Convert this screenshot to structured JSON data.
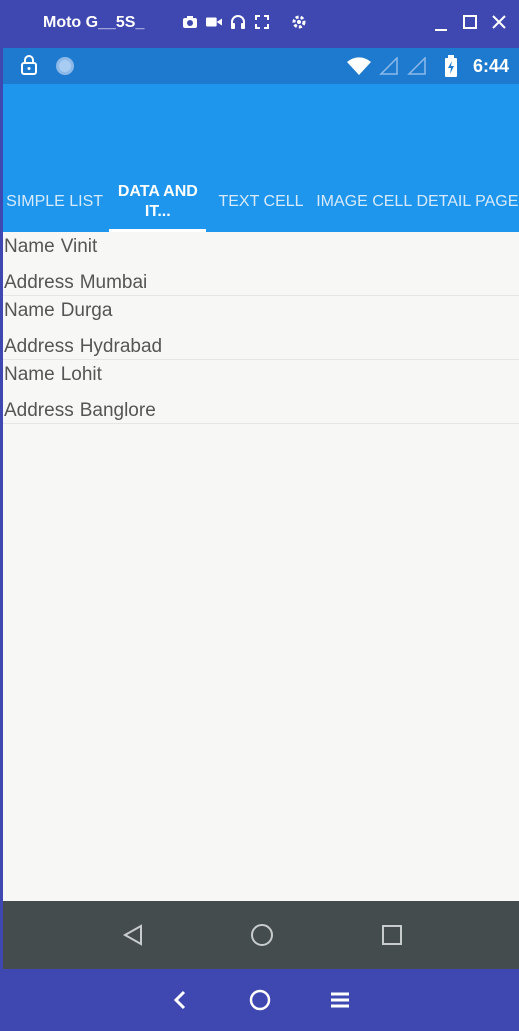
{
  "window": {
    "title": "Moto G__5S_"
  },
  "status": {
    "time": "6:44"
  },
  "tabs": [
    {
      "label": "SIMPLE LIST"
    },
    {
      "label": "DATA AND IT..."
    },
    {
      "label": "TEXT CELL"
    },
    {
      "label": "IMAGE CELL"
    },
    {
      "label": "DETAIL PAGE"
    }
  ],
  "items": [
    {
      "name_label": "Name",
      "name": "Vinit",
      "address_label": "Address",
      "address": "Mumbai"
    },
    {
      "name_label": "Name",
      "name": "Durga",
      "address_label": "Address",
      "address": "Hydrabad"
    },
    {
      "name_label": "Name",
      "name": "Lohit",
      "address_label": "Address",
      "address": "Banglore"
    }
  ],
  "colors": {
    "appbar": "#1E96EE",
    "statusbar": "#1E7ACF",
    "host": "#3F48B0",
    "navbar": "#454C4D"
  }
}
